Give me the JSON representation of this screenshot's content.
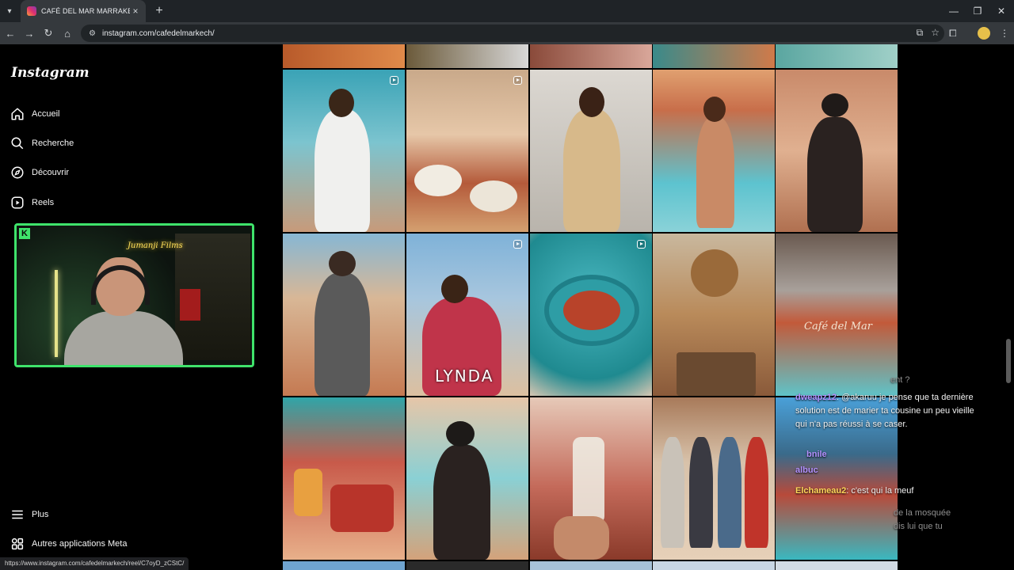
{
  "browser": {
    "tab_title": "CAFÉ DEL MAR MARRAKECH O",
    "url": "instagram.com/cafedelmarkech/",
    "status_url": "https://www.instagram.com/cafedelmarkech/reel/C7oyD_zCStC/"
  },
  "sidebar": {
    "logo": "Instagram",
    "items": [
      {
        "label": "Accueil",
        "icon": "home-icon"
      },
      {
        "label": "Recherche",
        "icon": "search-icon"
      },
      {
        "label": "Découvrir",
        "icon": "compass-icon"
      },
      {
        "label": "Reels",
        "icon": "reels-icon"
      }
    ],
    "bottom_items": [
      {
        "label": "Plus",
        "icon": "menu-icon"
      },
      {
        "label": "Autres applications Meta",
        "icon": "apps-icon"
      }
    ]
  },
  "webcam": {
    "sign_text": "Jumanji Films"
  },
  "grid": {
    "overlay_text": "LYNDA",
    "sign_text": "Café del Mar"
  },
  "chat": {
    "lines": [
      {
        "user": "",
        "text": "ent ?"
      },
      {
        "user": "dweapz12",
        "text": "@akaruu je pense que ta dernière solution est de marier ta cousine un peu vieille qui n'a pas réussi à se caser."
      },
      {
        "user": "bnile",
        "text": ""
      },
      {
        "user": "albuc",
        "text": ""
      },
      {
        "user": "Elchameau2",
        "text": "c'est qui la meuf"
      },
      {
        "user": "",
        "text": "de la mosquée"
      },
      {
        "user": "",
        "text": "dis lui que tu"
      }
    ]
  },
  "colors": {
    "accent_webcam": "#3fe36b",
    "chat_username": "#b391ff"
  }
}
